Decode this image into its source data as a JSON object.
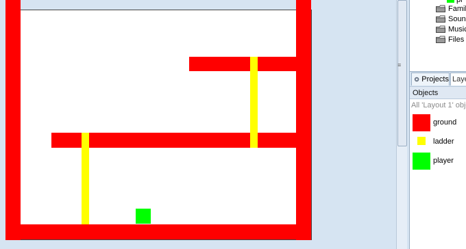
{
  "canvas": {
    "objects": [
      {
        "type": "ground",
        "color": "#ff0000",
        "name": "wall-left"
      },
      {
        "type": "ground",
        "color": "#ff0000",
        "name": "wall-right"
      },
      {
        "type": "ground",
        "color": "#ff0000",
        "name": "floor"
      },
      {
        "type": "ground",
        "color": "#ff0000",
        "name": "platform-upper"
      },
      {
        "type": "ground",
        "color": "#ff0000",
        "name": "platform-middle"
      },
      {
        "type": "ladder",
        "color": "#ffff00",
        "name": "ladder-upper"
      },
      {
        "type": "ladder",
        "color": "#ffff00",
        "name": "ladder-lower"
      },
      {
        "type": "player",
        "color": "#00ff00",
        "name": "player"
      }
    ]
  },
  "project_tree": {
    "items": [
      {
        "label": "Famili",
        "icon": "folder-icon"
      },
      {
        "label": "Sound",
        "icon": "folder-icon"
      },
      {
        "label": "Music",
        "icon": "folder-icon"
      },
      {
        "label": "Files",
        "icon": "folder-icon"
      }
    ]
  },
  "tabs": {
    "projects": "Projects",
    "layers": "Laye"
  },
  "objects_panel": {
    "header": "Objects",
    "filter_text": "All 'Layout 1' obje",
    "items": [
      {
        "label": "ground",
        "color": "#ff0000"
      },
      {
        "label": "ladder",
        "color": "#ffff00"
      },
      {
        "label": "player",
        "color": "#00ff00"
      }
    ]
  },
  "colors": {
    "ground": "#ff0000",
    "ladder": "#ffff00",
    "player": "#00ff00",
    "background": "#d6e4f2"
  }
}
